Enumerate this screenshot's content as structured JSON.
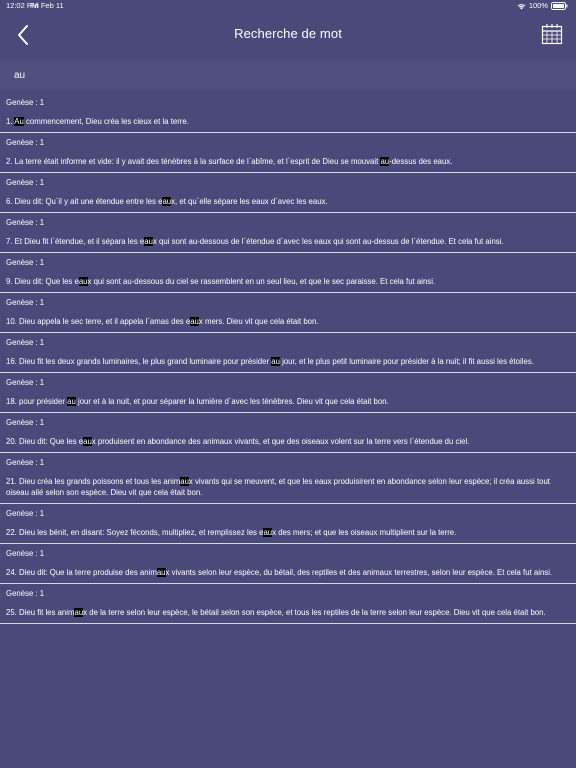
{
  "status_bar": {
    "time": "12:02 PM",
    "date": "Fri Feb 11",
    "battery": "100%"
  },
  "nav": {
    "title": "Recherche de mot",
    "back_icon": "chevron-left-icon",
    "calendar_icon": "calendar-icon"
  },
  "search": {
    "value": "au",
    "placeholder": ""
  },
  "colors": {
    "background": "#4a4a7a",
    "divider": "#d8d8e4",
    "highlight": "#000000"
  },
  "results": [
    {
      "ref": "Genèse : 1",
      "parts": [
        [
          "1. ",
          false
        ],
        [
          "Au",
          true
        ],
        [
          " commencement, Dieu créa les cieux et la terre.",
          false
        ]
      ]
    },
    {
      "ref": "Genèse : 1",
      "parts": [
        [
          "2. La terre était informe et vide: il y avait des ténèbres à la surface de l`abîme, et l`esprit de Dieu se mouvait ",
          false
        ],
        [
          "au",
          true
        ],
        [
          "-dessus des eaux.",
          false
        ]
      ]
    },
    {
      "ref": "Genèse : 1",
      "parts": [
        [
          "6. Dieu dit: Qu`il y ait une étendue entre les e",
          false
        ],
        [
          "au",
          true
        ],
        [
          "x, et qu`elle sépare les eaux d`avec les eaux.",
          false
        ]
      ]
    },
    {
      "ref": "Genèse : 1",
      "parts": [
        [
          "7. Et Dieu fit l`étendue, et il sépara les e",
          false
        ],
        [
          "au",
          true
        ],
        [
          "x qui sont au-dessous de l`étendue d`avec les eaux qui sont au-dessus de l`étendue. Et cela fut ainsi.",
          false
        ]
      ]
    },
    {
      "ref": "Genèse : 1",
      "parts": [
        [
          "9. Dieu dit: Que les e",
          false
        ],
        [
          "au",
          true
        ],
        [
          "x qui sont au-dessous du ciel se rassemblent en un seul lieu, et que le sec paraisse. Et cela fut ainsi.",
          false
        ]
      ]
    },
    {
      "ref": "Genèse : 1",
      "parts": [
        [
          "10. Dieu appela le sec terre, et il appela l`amas des e",
          false
        ],
        [
          "au",
          true
        ],
        [
          "x mers. Dieu vit que cela était bon.",
          false
        ]
      ]
    },
    {
      "ref": "Genèse : 1",
      "parts": [
        [
          "16. Dieu fit les deux grands luminaires, le plus grand luminaire pour présider ",
          false
        ],
        [
          "au",
          true
        ],
        [
          " jour, et le plus petit luminaire pour présider à la nuit; il fit aussi les étoiles.",
          false
        ]
      ]
    },
    {
      "ref": "Genèse : 1",
      "parts": [
        [
          "18. pour présider ",
          false
        ],
        [
          "au",
          true
        ],
        [
          " jour et à la nuit, et pour séparer la lumière d`avec les ténèbres. Dieu vit que cela était bon.",
          false
        ]
      ]
    },
    {
      "ref": "Genèse : 1",
      "parts": [
        [
          "20. Dieu dit: Que les e",
          false
        ],
        [
          "au",
          true
        ],
        [
          "x produisent en abondance des animaux vivants, et que des oiseaux volent sur la terre vers l`étendue du ciel.",
          false
        ]
      ]
    },
    {
      "ref": "Genèse : 1",
      "parts": [
        [
          "21. Dieu créa les grands poissons et tous les anim",
          false
        ],
        [
          "au",
          true
        ],
        [
          "x vivants qui se meuvent, et que les eaux produisirent en abondance selon leur espèce; il créa aussi tout oiseau ailé selon son espèce. Dieu vit que cela était bon.",
          false
        ]
      ]
    },
    {
      "ref": "Genèse : 1",
      "parts": [
        [
          "22. Dieu les bénit, en disant: Soyez féconds, multipliez, et remplissez les e",
          false
        ],
        [
          "au",
          true
        ],
        [
          "x des mers; et que les oiseaux multiplient sur la terre.",
          false
        ]
      ]
    },
    {
      "ref": "Genèse : 1",
      "parts": [
        [
          "24. Dieu dit: Que la terre produise des anim",
          false
        ],
        [
          "au",
          true
        ],
        [
          "x vivants selon leur espèce, du bétail, des reptiles et des animaux terrestres, selon leur espèce. Et cela fut ainsi.",
          false
        ]
      ]
    },
    {
      "ref": "Genèse : 1",
      "parts": [
        [
          "25. Dieu fit les anim",
          false
        ],
        [
          "au",
          true
        ],
        [
          "x de la terre selon leur espèce, le bétail selon son espèce, et tous les reptiles de la terre selon leur espèce. Dieu vit que cela était bon.",
          false
        ]
      ]
    }
  ]
}
